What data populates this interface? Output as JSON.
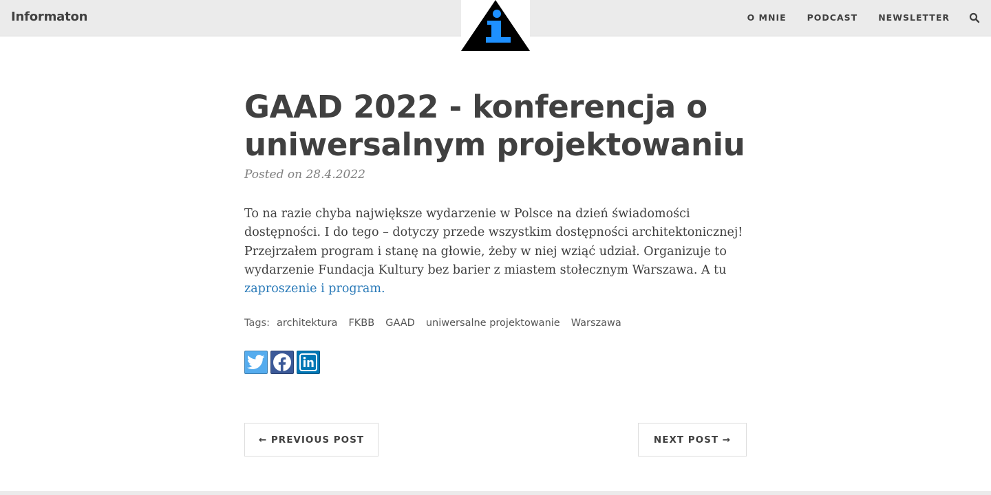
{
  "header": {
    "brand": "Informaton",
    "nav": [
      "O MNIE",
      "PODCAST",
      "NEWSLETTER"
    ],
    "logo_icon": "info-triangle-logo",
    "search_icon": "search-icon"
  },
  "post": {
    "title": "GAAD 2022 - konferencja o uniwersalnym projektowaniu",
    "meta": "Posted on 28.4.2022",
    "body_text": "To na razie chyba największe wydarzenie w Polsce na dzień świadomości dostępności. I do tego – dotyczy przede wszystkim dostępności architektonicznej! Przejrzałem program i stanę na głowie, żeby w niej wziąć udział. Organizuje to wydarzenie Fundacja Kultury bez barier z miastem stołecznym Warszawa. A tu ",
    "link_text": "zaproszenie i program.",
    "tags_label": "Tags:",
    "tags": [
      "architektura",
      "FKBB",
      "GAAD",
      "uniwersalne projektowanie",
      "Warszawa"
    ]
  },
  "share": {
    "twitter_icon": "twitter-icon",
    "facebook_icon": "facebook-icon",
    "linkedin_icon": "linkedin-icon"
  },
  "pager": {
    "prev": "← PREVIOUS POST",
    "next": "NEXT POST →"
  },
  "colors": {
    "navbar_bg": "#ebebeb",
    "text": "#404040",
    "link": "#2a7ab8",
    "logo_blue": "#1e90ff"
  }
}
